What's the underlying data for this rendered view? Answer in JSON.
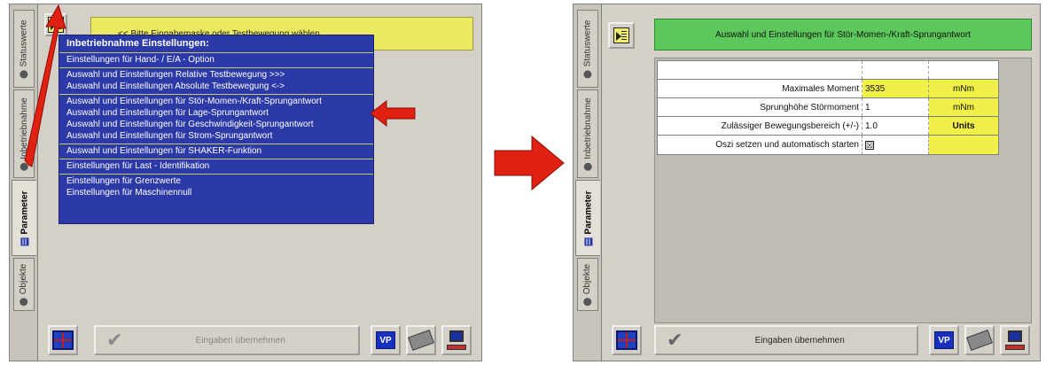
{
  "left": {
    "tabs": [
      {
        "label": "Statuswerte",
        "active": false
      },
      {
        "label": "Inbetriebnahme",
        "active": false
      },
      {
        "label": "Parameter",
        "active": true
      },
      {
        "label": "Objekte",
        "active": false
      }
    ],
    "hint": "<< Bitte Eingabemaske oder Testbewegung wählen",
    "menu": {
      "header": "Inbetriebnahme Einstellungen:",
      "groups": [
        [
          "Einstellungen für Hand- / E/A - Option"
        ],
        [
          "Auswahl und Einstellungen Relative Testbewegung >>>",
          "Auswahl und Einstellungen Absolute Testbewegung <->"
        ],
        [
          "Auswahl und Einstellungen für Stör-Momen-/Kraft-Sprungantwort",
          "Auswahl und Einstellungen für Lage-Sprungantwort",
          "Auswahl und Einstellungen für Geschwindigkeit-Sprungantwort",
          "Auswahl und Einstellungen für Strom-Sprungantwort"
        ],
        [
          "Auswahl und Einstellungen für SHAKER-Funktion"
        ],
        [
          "Einstellungen für Last - Identifikation"
        ],
        [
          "Einstellungen für Grenzwerte",
          "Einstellungen für Maschinennull"
        ]
      ]
    },
    "accept_label": "Eingaben übernehmen",
    "vp_label": "VP"
  },
  "right": {
    "tabs": [
      {
        "label": "Statuswerte",
        "active": false
      },
      {
        "label": "Inbetriebnahme",
        "active": false
      },
      {
        "label": "Parameter",
        "active": true
      },
      {
        "label": "Objekte",
        "active": false
      }
    ],
    "title": "Auswahl und Einstellungen für Stör-Momen-/Kraft-Sprungantwort",
    "rows": [
      {
        "label": "Maximales Moment",
        "value": "3535",
        "unit": "mNm"
      },
      {
        "label": "Sprunghöhe Störmoment",
        "value": "1",
        "unit": "mNm"
      },
      {
        "label": "Zulässiger Bewegungsbereich (+/-)",
        "value": "1.0",
        "unit": "Units"
      },
      {
        "label": "Oszi setzen und automatisch starten",
        "value": "☒",
        "unit": ""
      }
    ],
    "accept_label": "Eingaben übernehmen",
    "vp_label": "VP"
  },
  "colors": {
    "menu_bg": "#2c3aa8",
    "title_green": "#5cc85c",
    "field_yellow": "#f0f048",
    "arrow_red": "#e02010"
  }
}
